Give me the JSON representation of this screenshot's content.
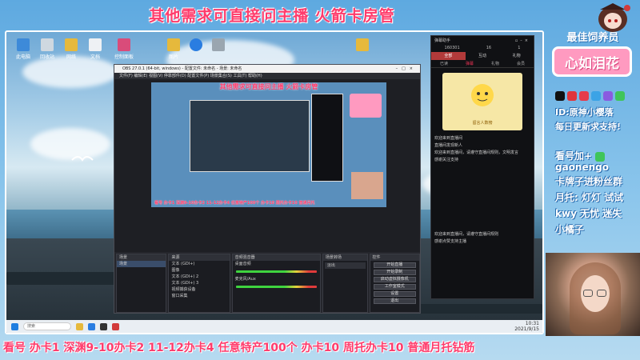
{
  "top_banner": "其他需求可直接问主播 火箭卡房管",
  "bottom_banner": "看号 办卡1 深渊9-10办卡2 11-12办卡4 任意特产100个 办卡10 周托办卡10 普通月托钻筋",
  "side": {
    "title": "最佳饲养员",
    "badge": "心如泪花",
    "id_line": "ID:原神小樱落",
    "update_line": "每日更新求支持!",
    "wechat_line1": "看号加+",
    "wechat_id": "gaonengo",
    "wechat_line2": "卡牌子进粉丝群",
    "monthly_line1": "月托: 灯灯 试试",
    "monthly_line2": "kwy 无忧 迷失",
    "monthly_line3": "小橘子"
  },
  "obs": {
    "title": "OBS 27.0.1 (64-bit, windows) - 配置文件: 未命名 - 场景: 未命名",
    "menu": "文件(F)  编辑(E)  视图(V)  停靠部件(D)  配置文件(P)  场景集合(S)  工具(T)  帮助(H)",
    "preview_banner": "其他需求可直接问主播 火箭卡房管",
    "preview_ticker": "看号 办卡1 深渊9-10办卡2 11-12办卡4 任意特产100个 办卡10 周托办卡10 普通月托",
    "panels": {
      "scenes": "场景",
      "sources": "来源",
      "mixer": "音频混音器",
      "transitions": "场景转场",
      "controls": "控件"
    },
    "sources": [
      "文本 (GDI+)",
      "图像",
      "文本 (GDI+) 2",
      "文本 (GDI+) 3",
      "视频捕获设备",
      "窗口采集"
    ],
    "mixer_items": [
      "桌面音频",
      "麦克风/Aux"
    ],
    "transition_value": "淡出",
    "controls": [
      "开始直播",
      "开始录制",
      "启动虚拟摄像机",
      "工作室模式",
      "设置",
      "退出"
    ]
  },
  "chat": {
    "title": "弹幕助手",
    "stats": [
      "160301",
      "16",
      "1"
    ],
    "tabs": [
      "全部",
      "互动",
      "礼物"
    ],
    "sub_tabs": [
      "已读",
      "弹幕",
      "礼物",
      "会员"
    ],
    "card_tag": "留言人数榜",
    "messages": [
      "欢迎来到直播间",
      "直播间发现新人",
      "欢迎来到直播间，请遵守直播间规则，文明发言",
      "感谢关注支持"
    ],
    "bottom_messages": [
      "欢迎来到直播间，请遵守直播间规则",
      "感谢点赞支持主播"
    ]
  },
  "taskbar": {
    "search_placeholder": "搜索",
    "time": "10:31",
    "date": "2021/9/15"
  },
  "desktop_icons": [
    "此电脑",
    "回收站",
    "网络",
    "文档",
    "控制面板",
    "图片"
  ],
  "colors": {
    "banner_text": "#ff3b6b",
    "badge_bg": "#ff9ac0",
    "obs_bg": "#1e1f24",
    "chat_tab_active": "#b23a3a"
  }
}
